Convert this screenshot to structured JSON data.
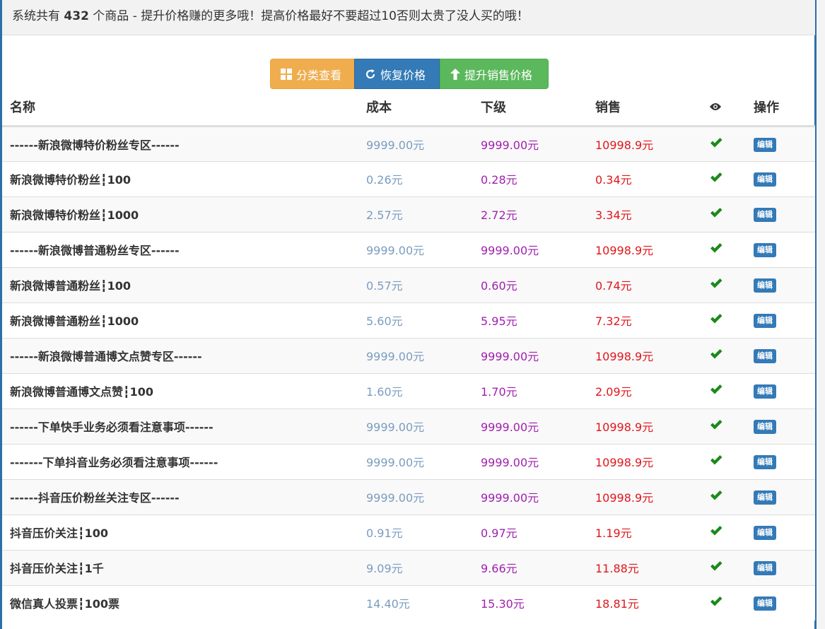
{
  "notice": {
    "prefix": "系统共有 ",
    "count": "432",
    "suffix": " 个商品 - 提升价格赚的更多哦！提高价格最好不要超过10否则太贵了没人买的哦！"
  },
  "toolbar": {
    "category_label": "分类查看",
    "restore_label": "恢复价格",
    "raise_label": "提升销售价格"
  },
  "table": {
    "headers": {
      "name": "名称",
      "cost": "成本",
      "lower": "下级",
      "sale": "销售",
      "ops": "操作"
    },
    "edit_label": "编辑",
    "rows": [
      {
        "name": "------新浪微博特价粉丝专区------",
        "cost": "9999.00元",
        "lower": "9999.00元",
        "sale": "10998.9元"
      },
      {
        "name": "新浪微博特价粉丝┇100",
        "cost": "0.26元",
        "lower": "0.28元",
        "sale": "0.34元"
      },
      {
        "name": "新浪微博特价粉丝┇1000",
        "cost": "2.57元",
        "lower": "2.72元",
        "sale": "3.34元"
      },
      {
        "name": "------新浪微博普通粉丝专区------",
        "cost": "9999.00元",
        "lower": "9999.00元",
        "sale": "10998.9元"
      },
      {
        "name": "新浪微博普通粉丝┇100",
        "cost": "0.57元",
        "lower": "0.60元",
        "sale": "0.74元"
      },
      {
        "name": "新浪微博普通粉丝┇1000",
        "cost": "5.60元",
        "lower": "5.95元",
        "sale": "7.32元"
      },
      {
        "name": "------新浪微博普通博文点赞专区------",
        "cost": "9999.00元",
        "lower": "9999.00元",
        "sale": "10998.9元"
      },
      {
        "name": "新浪微博普通博文点赞┇100",
        "cost": "1.60元",
        "lower": "1.70元",
        "sale": "2.09元"
      },
      {
        "name": "------下单快手业务必须看注意事项------",
        "cost": "9999.00元",
        "lower": "9999.00元",
        "sale": "10998.9元"
      },
      {
        "name": "-------下单抖音业务必须看注意事项------",
        "cost": "9999.00元",
        "lower": "9999.00元",
        "sale": "10998.9元"
      },
      {
        "name": "------抖音压价粉丝关注专区------",
        "cost": "9999.00元",
        "lower": "9999.00元",
        "sale": "10998.9元"
      },
      {
        "name": "抖音压价关注┇100",
        "cost": "0.91元",
        "lower": "0.97元",
        "sale": "1.19元"
      },
      {
        "name": "抖音压价关注┇1千",
        "cost": "9.09元",
        "lower": "9.66元",
        "sale": "11.88元"
      },
      {
        "name": "微信真人投票┇100票",
        "cost": "14.40元",
        "lower": "15.30元",
        "sale": "18.81元"
      }
    ]
  },
  "colors": {
    "cost": "#7a9cc0",
    "lower": "#a020b0",
    "sale": "#e0161b",
    "check": "#1a8a1a",
    "primary": "#337ab7"
  },
  "icons": {
    "category": "th-large-icon",
    "restore": "refresh-icon",
    "raise": "arrow-up-icon",
    "visibility": "eye-icon",
    "status": "check-icon"
  }
}
